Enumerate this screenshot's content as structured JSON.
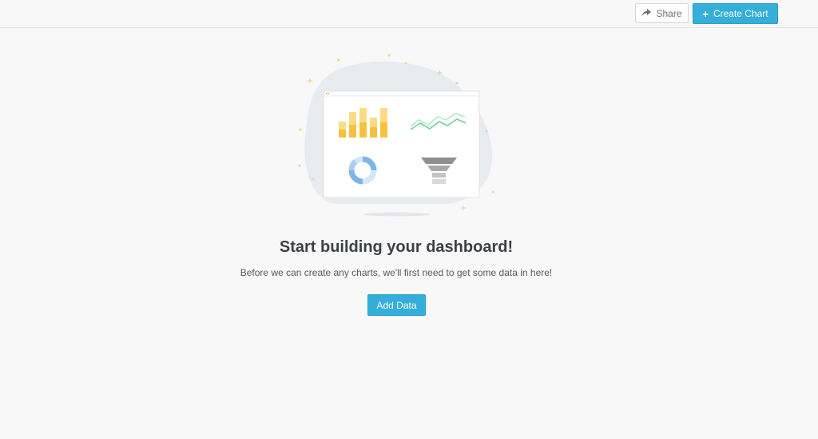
{
  "toolbar": {
    "share_label": "Share",
    "create_chart_label": "Create Chart"
  },
  "empty_state": {
    "title": "Start building your dashboard!",
    "description": "Before we can create any charts, we'll first need to get some data in here!",
    "add_data_label": "Add Data"
  },
  "icons": {
    "share": "share-arrow-icon",
    "create": "plus-icon"
  },
  "colors": {
    "accent": "#34afd9",
    "background": "#f8f8f9",
    "bar_dark": "#f5c23d",
    "bar_light": "#fbdc84",
    "line_green": "#8fd9b0",
    "donut_blue": "#7db6e6",
    "funnel_gray": "#9a9a9a"
  }
}
